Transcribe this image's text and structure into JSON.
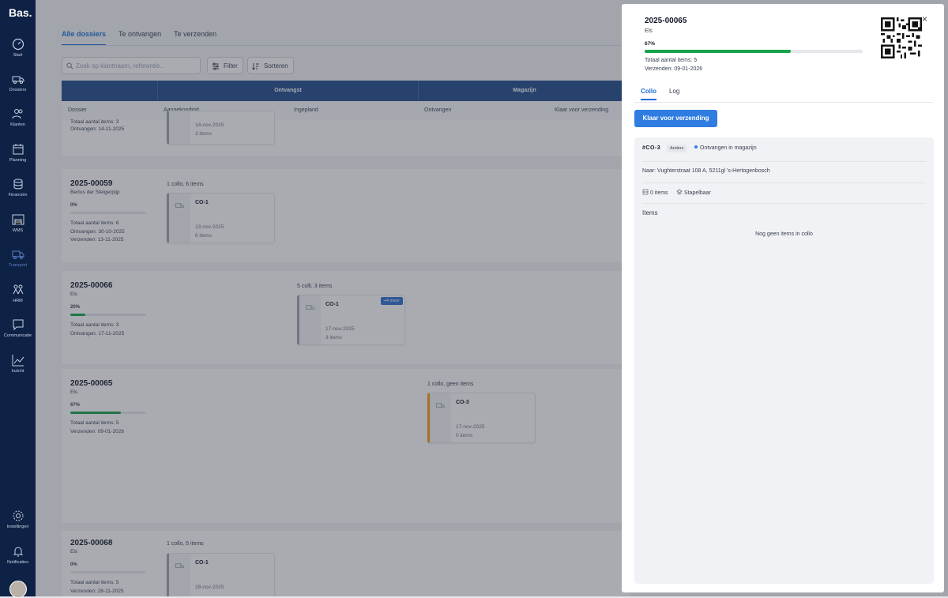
{
  "app": {
    "logo": "Bas."
  },
  "sidebar": {
    "items": [
      {
        "label": "Start",
        "icon": "gauge-icon"
      },
      {
        "label": "Dossiers",
        "icon": "truck-icon"
      },
      {
        "label": "Klanten",
        "icon": "users-icon"
      },
      {
        "label": "Planning",
        "icon": "calendar-icon"
      },
      {
        "label": "Financiën",
        "icon": "coins-icon"
      },
      {
        "label": "WMS",
        "icon": "warehouse-icon"
      },
      {
        "label": "Transport",
        "icon": "delivery-icon"
      },
      {
        "label": "HRM",
        "icon": "people-icon"
      },
      {
        "label": "Communicatie",
        "icon": "chat-icon"
      },
      {
        "label": "Inzicht",
        "icon": "chart-icon"
      },
      {
        "label": "Instellingen",
        "icon": "gear-icon"
      },
      {
        "label": "Notificaties",
        "icon": "bell-icon"
      }
    ]
  },
  "main": {
    "tabs": [
      "Alle dossiers",
      "Te ontvangen",
      "Te verzenden"
    ],
    "search_placeholder": "Zoek op klantnaam, referentie...",
    "filter_label": "Filter",
    "sort_label": "Sorteren",
    "group_headers": [
      "Ontvangst",
      "Magazijn"
    ],
    "columns": [
      "Dossier",
      "Aangekondigd",
      "Ingepland",
      "Ontvangen",
      "Klaar voor verzending"
    ],
    "rows": [
      {
        "lines": [
          "Totaal aantal items: 3",
          "Ontvangen: 14-11-2025"
        ],
        "card": {
          "date": "14-nov-2025",
          "items": "3 items"
        }
      },
      {
        "id": "2025-00059",
        "name": "Bertus der Steigerpijp",
        "pct_label": "0%",
        "pct": 0,
        "lines": [
          "Totaal aantal items: 6",
          "Ontvangen: 30-10-2025",
          "Verzenden: 13-11-2025"
        ],
        "group_label": "1 collo, 6 items",
        "card": {
          "name": "CO-1",
          "date": "13-nov-2025",
          "items": "6 items"
        }
      },
      {
        "id": "2025-00066",
        "name": "Els",
        "pct_label": "20%",
        "pct": 20,
        "lines": [
          "Totaal aantal items: 3",
          "Ontvangen: 17-11-2025"
        ],
        "group_label": "5 colli, 3 items",
        "card": {
          "name": "CO-1",
          "date": "17-nov-2025",
          "items": "3 items",
          "more": "+4 meer"
        }
      },
      {
        "id": "2025-00065",
        "name": "Els",
        "pct_label": "67%",
        "pct": 67,
        "lines": [
          "Totaal aantal items: 5",
          "Verzenden: 09-01-2026"
        ],
        "group_label": "1 collo, geen items",
        "card": {
          "name": "CO-3",
          "date": "17-nov-2025",
          "items": "0 items"
        }
      },
      {
        "id": "2025-00068",
        "name": "Els",
        "pct_label": "0%",
        "pct": 0,
        "lines": [
          "Totaal aantal items: 5",
          "Verzenden: 28-11-2025"
        ],
        "group_label": "1 collo, 5 items",
        "card": {
          "name": "CO-1",
          "date": "28-nov-2025",
          "items": ""
        }
      }
    ]
  },
  "panel": {
    "id": "2025-00065",
    "name": "Els",
    "pct_label": "67%",
    "pct": 67,
    "total": "Totaal aantal items: 5",
    "ship": "Verzenden: 09-01-2026",
    "close": "×",
    "tabs": [
      "Collo",
      "Log"
    ],
    "action": "Klaar voor verzending",
    "collo": {
      "code": "#CO-3",
      "tag": "Anders",
      "status": "Ontvangen in magazijn",
      "address": "Naar: Vughterstraat 108 A, 5211gl 's-Hertogenbosch",
      "items_count": "0 items",
      "stackable": "Stapelbaar",
      "items_heading": "Items",
      "empty": "Nog geen items in collo"
    }
  },
  "colors": {
    "sidebar": "#0e2245",
    "header": "#1f4a8a",
    "accent": "#2f7de1",
    "progress": "#16a34a"
  }
}
